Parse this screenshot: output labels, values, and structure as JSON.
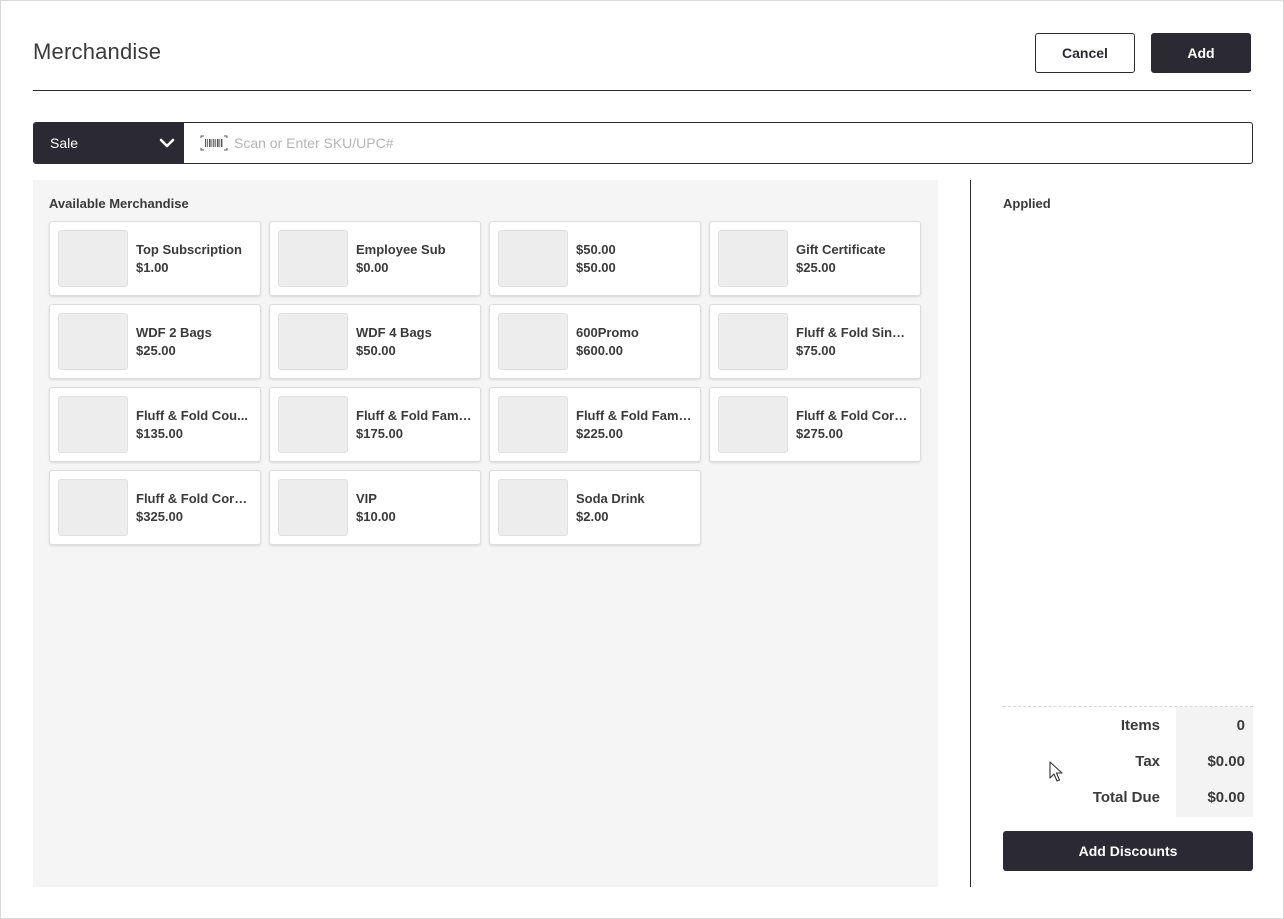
{
  "header": {
    "title": "Merchandise",
    "cancel_label": "Cancel",
    "add_label": "Add"
  },
  "search": {
    "mode_selected": "Sale",
    "placeholder": "Scan or Enter SKU/UPC#",
    "value": ""
  },
  "available": {
    "title": "Available Merchandise",
    "items": [
      {
        "name": "Top Subscription",
        "price": "$1.00"
      },
      {
        "name": "Employee Sub",
        "price": "$0.00"
      },
      {
        "name": "$50.00",
        "price": "$50.00"
      },
      {
        "name": "Gift Certificate",
        "price": "$25.00"
      },
      {
        "name": "WDF 2 Bags",
        "price": "$25.00"
      },
      {
        "name": "WDF 4 Bags",
        "price": "$50.00"
      },
      {
        "name": "600Promo",
        "price": "$600.00"
      },
      {
        "name": "Fluff & Fold Singl...",
        "price": "$75.00"
      },
      {
        "name": "Fluff & Fold Cou...",
        "price": "$135.00"
      },
      {
        "name": "Fluff & Fold Famil...",
        "price": "$175.00"
      },
      {
        "name": "Fluff & Fold Famil...",
        "price": "$225.00"
      },
      {
        "name": "Fluff & Fold Corp...",
        "price": "$275.00"
      },
      {
        "name": "Fluff & Fold Corp...",
        "price": "$325.00"
      },
      {
        "name": "VIP",
        "price": "$10.00"
      },
      {
        "name": "Soda Drink",
        "price": "$2.00"
      }
    ]
  },
  "applied": {
    "title": "Applied"
  },
  "totals": {
    "items_label": "Items",
    "items_value": "0",
    "tax_label": "Tax",
    "tax_value": "$0.00",
    "total_label": "Total Due",
    "total_value": "$0.00"
  },
  "discounts": {
    "button_label": "Add Discounts"
  },
  "colors": {
    "primary_dark": "#2b2a33",
    "panel_bg": "#f5f5f5"
  }
}
